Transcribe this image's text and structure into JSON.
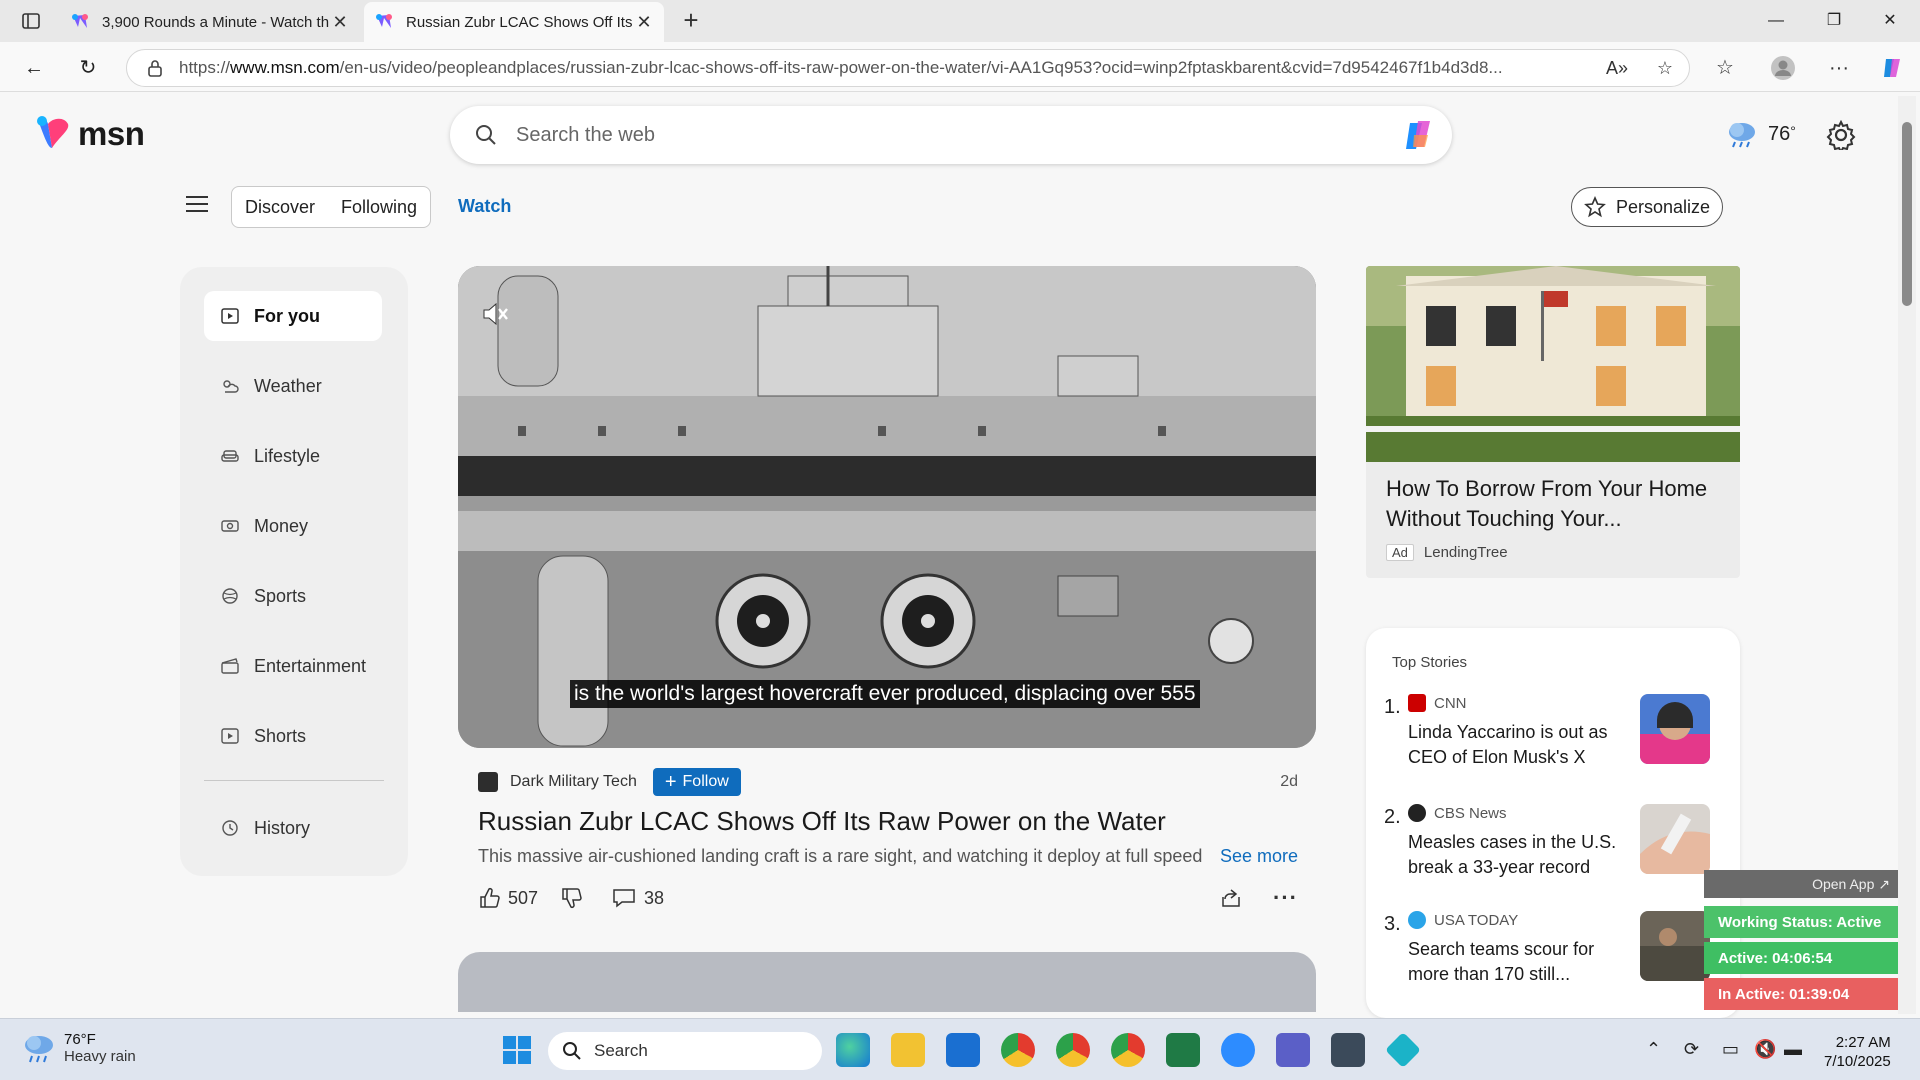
{
  "browser": {
    "tabs": [
      {
        "title": "3,900 Rounds a Minute - Watch th",
        "active": false
      },
      {
        "title": "Russian Zubr LCAC Shows Off Its R",
        "active": true
      }
    ],
    "url_prefix": "https://",
    "url_domain": "www.msn.com",
    "url_path": "/en-us/video/peopleandplaces/russian-zubr-lcac-shows-off-its-raw-power-on-the-water/vi-AA1Gq953?ocid=winp2fptaskbarent&cvid=7d9542467f1b4d3d8..."
  },
  "header": {
    "logo_text": "msn",
    "search_placeholder": "Search the web",
    "temperature": "76",
    "temp_unit": "°"
  },
  "nav": {
    "discover": "Discover",
    "following": "Following",
    "watch": "Watch",
    "personalize": "Personalize"
  },
  "sidebar": {
    "items": [
      {
        "label": "For you",
        "icon": "play-icon"
      },
      {
        "label": "Weather",
        "icon": "weather-icon"
      },
      {
        "label": "Lifestyle",
        "icon": "sofa-icon"
      },
      {
        "label": "Money",
        "icon": "money-icon"
      },
      {
        "label": "Sports",
        "icon": "ball-icon"
      },
      {
        "label": "Entertainment",
        "icon": "clapper-icon"
      },
      {
        "label": "Shorts",
        "icon": "play-icon"
      },
      {
        "label": "History",
        "icon": "history-icon"
      }
    ]
  },
  "video": {
    "caption": "is the world's largest hovercraft ever produced, displacing over 555",
    "source": "Dark Military Tech",
    "follow_label": "Follow",
    "age": "2d",
    "title": "Russian Zubr LCAC Shows Off Its Raw Power on the Water",
    "description": "This massive air-cushioned landing craft is a rare sight, and watching it deploy at full speed is...",
    "see_more": "See more",
    "likes": "507",
    "comments": "38"
  },
  "ad": {
    "title": "How To Borrow From Your Home Without Touching Your...",
    "tag": "Ad",
    "advertiser": "LendingTree"
  },
  "top_stories": {
    "title": "Top Stories",
    "items": [
      {
        "num": "1.",
        "source": "CNN",
        "headline": "Linda Yaccarino is out as CEO of Elon Musk's X"
      },
      {
        "num": "2.",
        "source": "CBS News",
        "headline": "Measles cases in the U.S. break a 33-year record"
      },
      {
        "num": "3.",
        "source": "USA TODAY",
        "headline": "Search teams scour for more than 170 still..."
      }
    ]
  },
  "overlay": {
    "open_app": "Open App ↗",
    "working_status": "Working Status: Active",
    "active": "Active: 04:06:54",
    "inactive": "In Active: 01:39:04"
  },
  "taskbar": {
    "weather_temp": "76°F",
    "weather_desc": "Heavy rain",
    "search": "Search",
    "time": "2:27 AM",
    "date": "7/10/2025"
  },
  "colors": {
    "accent": "#0f6cbd",
    "active_green": "#4cc26a",
    "inactive_red": "#e86060"
  }
}
